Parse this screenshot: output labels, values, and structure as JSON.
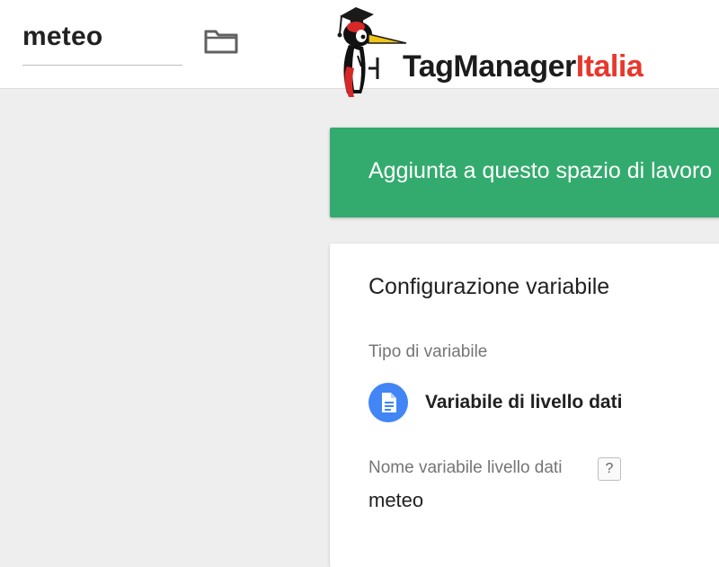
{
  "header": {
    "variable_name": "meteo",
    "folder_icon": "folder-icon",
    "logo": {
      "text_dark": "TagManager",
      "text_accent": "Italia"
    }
  },
  "banner": {
    "text": "Aggiunta a questo spazio di lavoro",
    "color": "#33ab6e"
  },
  "config": {
    "title": "Configurazione variabile",
    "type_label": "Tipo di variabile",
    "type_value": "Variabile di livello dati",
    "type_icon": "document-icon",
    "type_icon_color": "#4285f4",
    "dlv_name_label": "Nome variabile livello dati",
    "help_symbol": "?",
    "dlv_name_value": "meteo"
  },
  "colors": {
    "logo_accent": "#e8372c",
    "background": "#eeeeee"
  }
}
